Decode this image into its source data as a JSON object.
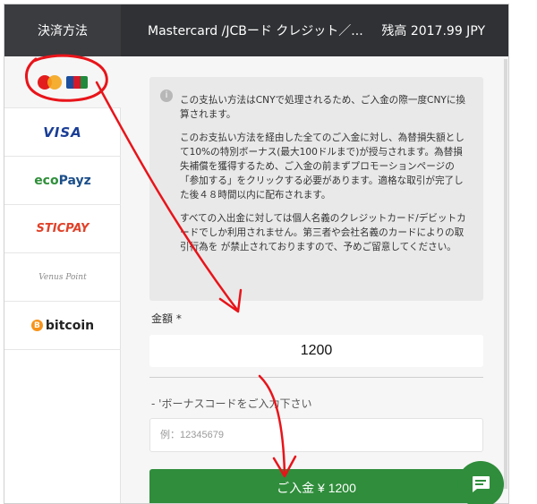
{
  "header": {
    "tab_label": "決済方法",
    "title": "Mastercard /JCBード クレジット／...",
    "balance": "残高 2017.99 JPY"
  },
  "sidebar": {
    "methods": [
      {
        "name": "mastercard-jcb",
        "active": true
      },
      {
        "name": "visa",
        "logo_text": "VISA"
      },
      {
        "name": "ecopayz",
        "logo_text_a": "eco",
        "logo_text_b": "Payz"
      },
      {
        "name": "sticpay",
        "logo_text": "STICPAY"
      },
      {
        "name": "venuspoint",
        "logo_text": "Venus Point"
      },
      {
        "name": "bitcoin",
        "logo_text": "bitcoin",
        "coin_symbol": "B"
      }
    ]
  },
  "notice": {
    "icon": "info-icon",
    "paragraphs": [
      "この支払い方法はCNYで処理されるため、ご入金の際一度CNYに換算されます。",
      "このお支払い方法を経由した全てのご入金に対し、為替損失額として10%の特別ボーナス(最大100ドルまで)が授与されます。為替損失補償を獲得するため、ご入金の前まずプロモーションページの「参加する」をクリックする必要があります。適格な取引が完了した後４８時間以内に配布されます。",
      "すべての入出金に対しては個人名義のクレジットカード/デビットカードでしか利用されません。第三者や会社名義のカードによりの取引行為を が禁止されておりますので、予めご留意してください。"
    ]
  },
  "form": {
    "amount_label": "金額 *",
    "amount_value": "1200",
    "bonus_label": "- 'ボーナスコードをご入力下さい",
    "bonus_placeholder": "例：12345679",
    "submit_label": "ご入金 ¥ 1200"
  },
  "colors": {
    "header_bg": "#2f3134",
    "accent_green": "#2f8d3b",
    "annotation_red": "#e8141a"
  }
}
